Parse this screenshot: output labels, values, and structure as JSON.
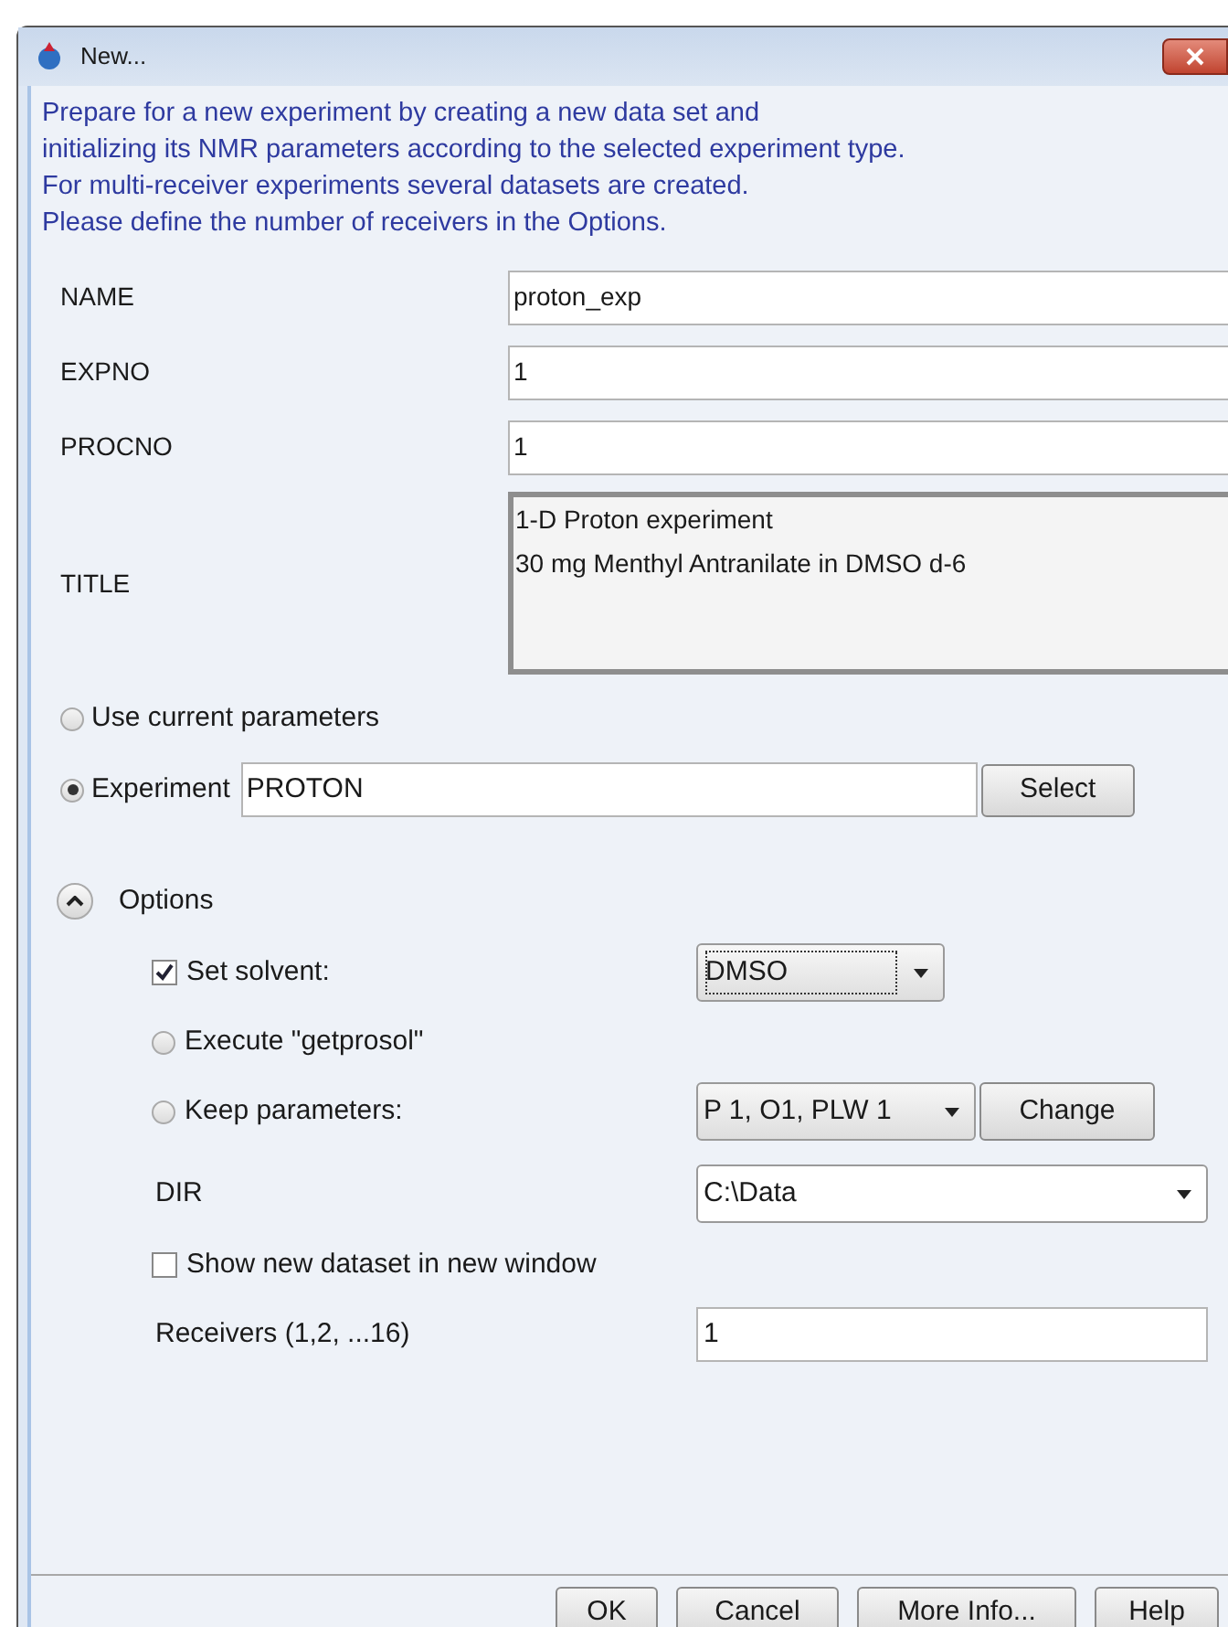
{
  "window": {
    "title": "New..."
  },
  "description": [
    "Prepare for a new experiment by creating a new data set and",
    "initializing its NMR parameters according to the selected experiment type.",
    "For multi-receiver experiments several datasets are created.",
    "Please define the number of receivers in the Options."
  ],
  "fields": [
    {
      "label": "NAME",
      "value": "proton_exp"
    },
    {
      "label": "EXPNO",
      "value": "1"
    },
    {
      "label": "PROCNO",
      "value": "1"
    }
  ],
  "title_field": {
    "label": "TITLE",
    "lines": [
      "1-D Proton experiment",
      "30 mg Menthyl Antranilate in DMSO d-6"
    ]
  },
  "sources": [
    {
      "kind": "plain",
      "label": "Use current parameters",
      "selected": false
    },
    {
      "kind": "input",
      "label": "Experiment",
      "selected": true,
      "value": "PROTON",
      "button": "Select"
    }
  ],
  "options": {
    "label": "Options",
    "expanded": true,
    "items": [
      {
        "kind": "checkbox",
        "label": "Set solvent:",
        "checked": true,
        "combo": "DMSO"
      },
      {
        "kind": "radio",
        "label": "Execute \"getprosol\"",
        "selected": false
      },
      {
        "kind": "radio",
        "label": "Keep parameters:",
        "selected": false,
        "combo": "P 1, O1, PLW 1",
        "button": "Change"
      },
      {
        "kind": "combo",
        "label": "DIR",
        "combo": "C:\\Data"
      },
      {
        "kind": "checkbox",
        "label": "Show new dataset in new window",
        "checked": false
      },
      {
        "kind": "input",
        "label": "Receivers (1,2, ...16)",
        "value": "1"
      }
    ]
  },
  "buttons": [
    "OK",
    "Cancel",
    "More Info...",
    "Help"
  ]
}
